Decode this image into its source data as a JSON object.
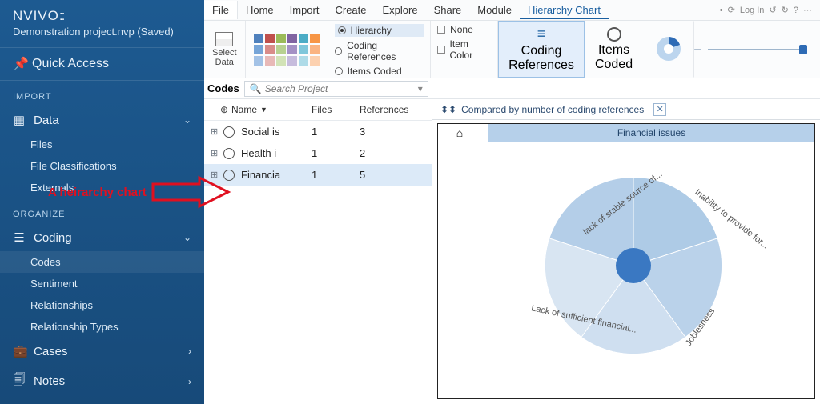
{
  "brand": "NVIVO",
  "project_status": "Demonstration project.nvp (Saved)",
  "quick_access": "Quick Access",
  "sections": {
    "import": {
      "label": "IMPORT",
      "data": "Data",
      "items": [
        "Files",
        "File Classifications",
        "Externals"
      ]
    },
    "organize": {
      "label": "ORGANIZE",
      "coding": "Coding",
      "items": [
        "Codes",
        "Sentiment",
        "Relationships",
        "Relationship Types"
      ],
      "cases": "Cases",
      "notes": "Notes"
    }
  },
  "menu": {
    "file": "File",
    "items": [
      "Home",
      "Import",
      "Create",
      "Explore",
      "Share",
      "Module"
    ],
    "active": "Hierarchy Chart",
    "login": "Log In"
  },
  "ribbon": {
    "select_data": "Select\nData",
    "opts_left": {
      "hierarchy": "Hierarchy",
      "coding_refs": "Coding References",
      "items_coded": "Items Coded"
    },
    "opts_right": {
      "none": "None",
      "item_color": "Item Color"
    },
    "btn_coding_refs": "Coding\nReferences",
    "btn_items_coded": "Items\nCoded"
  },
  "codes_panel": {
    "title": "Codes",
    "search_placeholder": "Search Project",
    "columns": {
      "name": "Name",
      "files": "Files",
      "refs": "References"
    },
    "rows": [
      {
        "name": "Social is",
        "files": "1",
        "refs": "3"
      },
      {
        "name": "Health i",
        "files": "1",
        "refs": "2"
      },
      {
        "name": "Financia",
        "files": "1",
        "refs": "5"
      }
    ]
  },
  "viz": {
    "tab": "Compared by number of coding references",
    "breadcrumb": "Financial issues",
    "annotation": "A heirarchy chart"
  },
  "chart_data": {
    "type": "pie",
    "title": "Financial issues",
    "series": [
      {
        "name": "lack of stable source of...",
        "value": 1
      },
      {
        "name": "Inability to provide for...",
        "value": 1
      },
      {
        "name": "Joblesness",
        "value": 1
      },
      {
        "name": "Lack of sufficient financial...",
        "value": 1
      },
      {
        "name": "",
        "value": 1
      }
    ]
  }
}
